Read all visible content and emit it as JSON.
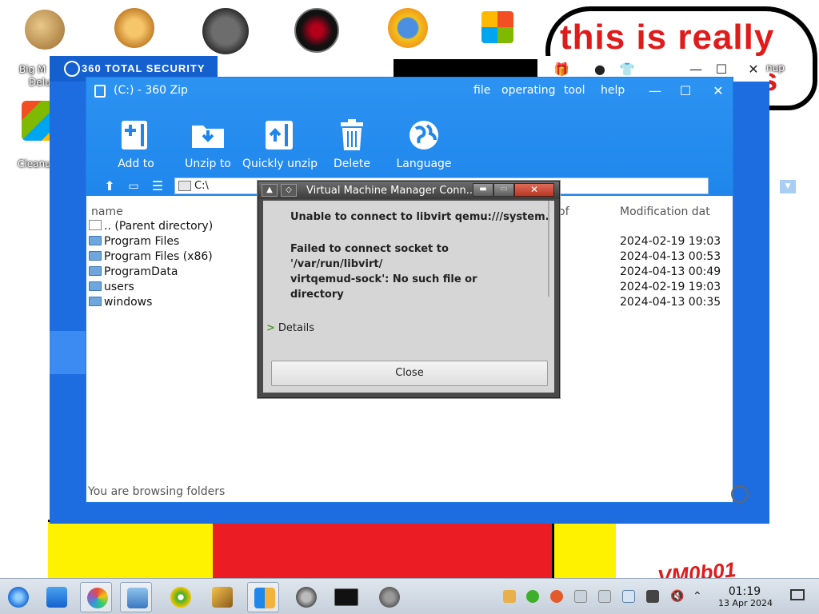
{
  "desktop": {
    "icons": [
      {
        "label": "Big Mo\nDelu",
        "icon": "money-bag-icon"
      },
      {
        "label": "Cleanu",
        "icon": "cleanup-icon"
      }
    ],
    "top_icons": [
      "gear-app-icon",
      "speedometer-icon",
      "dark-disc-icon",
      "sun-globe-icon",
      "office-grid-icon"
    ],
    "wallpaper_text": "this is really",
    "wallpaper_text2": "s",
    "watermark": "VM0b01",
    "bubble_side_text": "nup"
  },
  "security_window": {
    "title": "360 TOTAL SECURITY",
    "controls": {
      "minimize": "—",
      "maximize": "☐",
      "close": "✕"
    }
  },
  "zip_window": {
    "title": "(C:) - 360 Zip",
    "menu": [
      "file",
      "operating",
      "tool",
      "help"
    ],
    "controls": {
      "minimize": "—",
      "maximize": "☐",
      "close": "✕"
    },
    "toolbar": [
      {
        "label": "Add to",
        "icon": "add-archive-icon"
      },
      {
        "label": "Unzip to",
        "icon": "unzip-folder-icon"
      },
      {
        "label": "Quickly unzip",
        "icon": "quick-unzip-icon"
      },
      {
        "label": "Delete",
        "icon": "trash-icon"
      },
      {
        "label": "Language",
        "icon": "globe-icon"
      }
    ],
    "address": "C:\\",
    "columns": {
      "name": "name",
      "of": "of",
      "modified": "Modification dat"
    },
    "files": [
      {
        "name": ".. (Parent directory)",
        "modified": "",
        "type": "parent"
      },
      {
        "name": "Program Files",
        "modified": "2024-02-19 19:03",
        "type": "folder"
      },
      {
        "name": "Program Files (x86)",
        "modified": "2024-04-13 00:53",
        "type": "folder"
      },
      {
        "name": "ProgramData",
        "modified": "2024-04-13 00:49",
        "type": "folder"
      },
      {
        "name": "users",
        "modified": "2024-02-19 19:03",
        "type": "folder"
      },
      {
        "name": "windows",
        "modified": "2024-04-13 00:35",
        "type": "folder"
      }
    ],
    "status": "You are browsing folders"
  },
  "dialog": {
    "title": "Virtual Machine Manager Conn...",
    "message": "Unable to connect to libvirt qemu:///system.",
    "detail": "Failed to connect socket to '/var/run/libvirt/\nvirtqemud-sock': No such file or\ndirectory",
    "details_label": "Details",
    "close_label": "Close"
  },
  "taskbar": {
    "time": "01:19",
    "date": "13 Apr 2024",
    "items": [
      "start-orb-icon",
      "file-manager-icon",
      "shield-app-icon",
      "system-info-icon",
      "360-plus-icon",
      "broom-icon",
      "archive-icon",
      "flash-icon",
      "terminal-icon",
      "virt-manager-icon"
    ]
  }
}
